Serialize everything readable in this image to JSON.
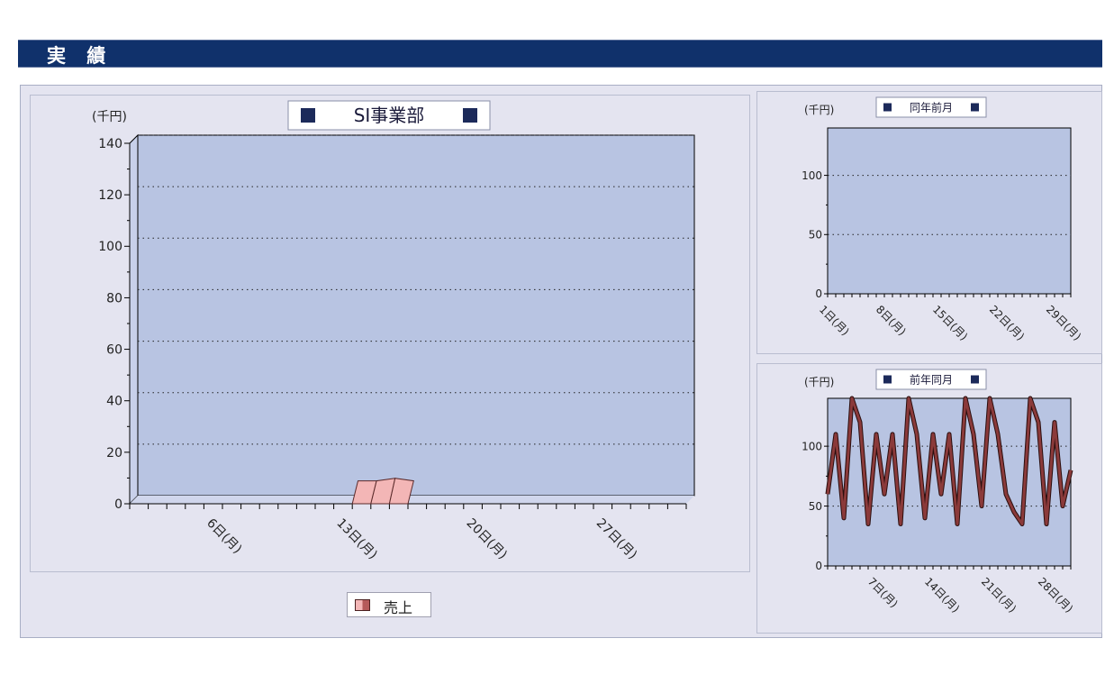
{
  "header": {
    "title": "実 績"
  },
  "colors": {
    "header_bg": "#10316b",
    "plot_bg": "#b8c4e2",
    "panel_bg": "#e4e4f0",
    "series_main": "#f3b6b6",
    "series_line": "#8b3a3a",
    "title_square": "#1c2a5a"
  },
  "chart_data": [
    {
      "type": "area",
      "title": "SI事業部",
      "ylabel": "(千円)",
      "ylim": [
        0,
        140
      ],
      "yticks": [
        "0",
        "20",
        "40",
        "60",
        "80",
        "100",
        "120",
        "140"
      ],
      "xlim": [
        1,
        31
      ],
      "xticks": [
        {
          "x": 6,
          "label": "6日(月)"
        },
        {
          "x": 13,
          "label": "13日(月)"
        },
        {
          "x": 20,
          "label": "20日(月)"
        },
        {
          "x": 27,
          "label": "27日(月)"
        }
      ],
      "grid": true,
      "legend": {
        "position": "bottom-center",
        "entries": [
          "売上"
        ]
      },
      "series": [
        {
          "name": "売上",
          "x": [
            13,
            14,
            15,
            16
          ],
          "values": [
            7,
            7,
            8,
            7
          ]
        }
      ]
    },
    {
      "type": "line",
      "title": "同年前月",
      "ylabel": "(千円)",
      "ylim": [
        0,
        140
      ],
      "yticks": [
        "0",
        "50",
        "100"
      ],
      "xlim": [
        1,
        31
      ],
      "xticks": [
        {
          "x": 1,
          "label": "1日(月)"
        },
        {
          "x": 8,
          "label": "8日(月)"
        },
        {
          "x": 15,
          "label": "15日(月)"
        },
        {
          "x": 22,
          "label": "22日(月)"
        },
        {
          "x": 29,
          "label": "29日(月)"
        }
      ],
      "grid": true,
      "series": []
    },
    {
      "type": "line",
      "title": "前年同月",
      "ylabel": "(千円)",
      "ylim": [
        0,
        140
      ],
      "yticks": [
        "0",
        "50",
        "100"
      ],
      "xlim": [
        1,
        31
      ],
      "xticks": [
        {
          "x": 7,
          "label": "7日(月)"
        },
        {
          "x": 14,
          "label": "14日(月)"
        },
        {
          "x": 21,
          "label": "21日(月)"
        },
        {
          "x": 28,
          "label": "28日(月)"
        }
      ],
      "grid": true,
      "series": [
        {
          "name": "",
          "x": [
            1,
            2,
            3,
            4,
            5,
            6,
            7,
            8,
            9,
            10,
            11,
            12,
            13,
            14,
            15,
            16,
            17,
            18,
            19,
            20,
            21,
            22,
            23,
            24,
            25,
            26,
            27,
            28,
            29,
            30,
            31
          ],
          "values": [
            60,
            110,
            40,
            140,
            120,
            35,
            110,
            60,
            110,
            35,
            140,
            110,
            40,
            110,
            60,
            110,
            35,
            140,
            110,
            50,
            140,
            110,
            60,
            45,
            35,
            140,
            120,
            35,
            120,
            50,
            80
          ]
        }
      ]
    }
  ],
  "legend_main": {
    "label": "売上"
  }
}
